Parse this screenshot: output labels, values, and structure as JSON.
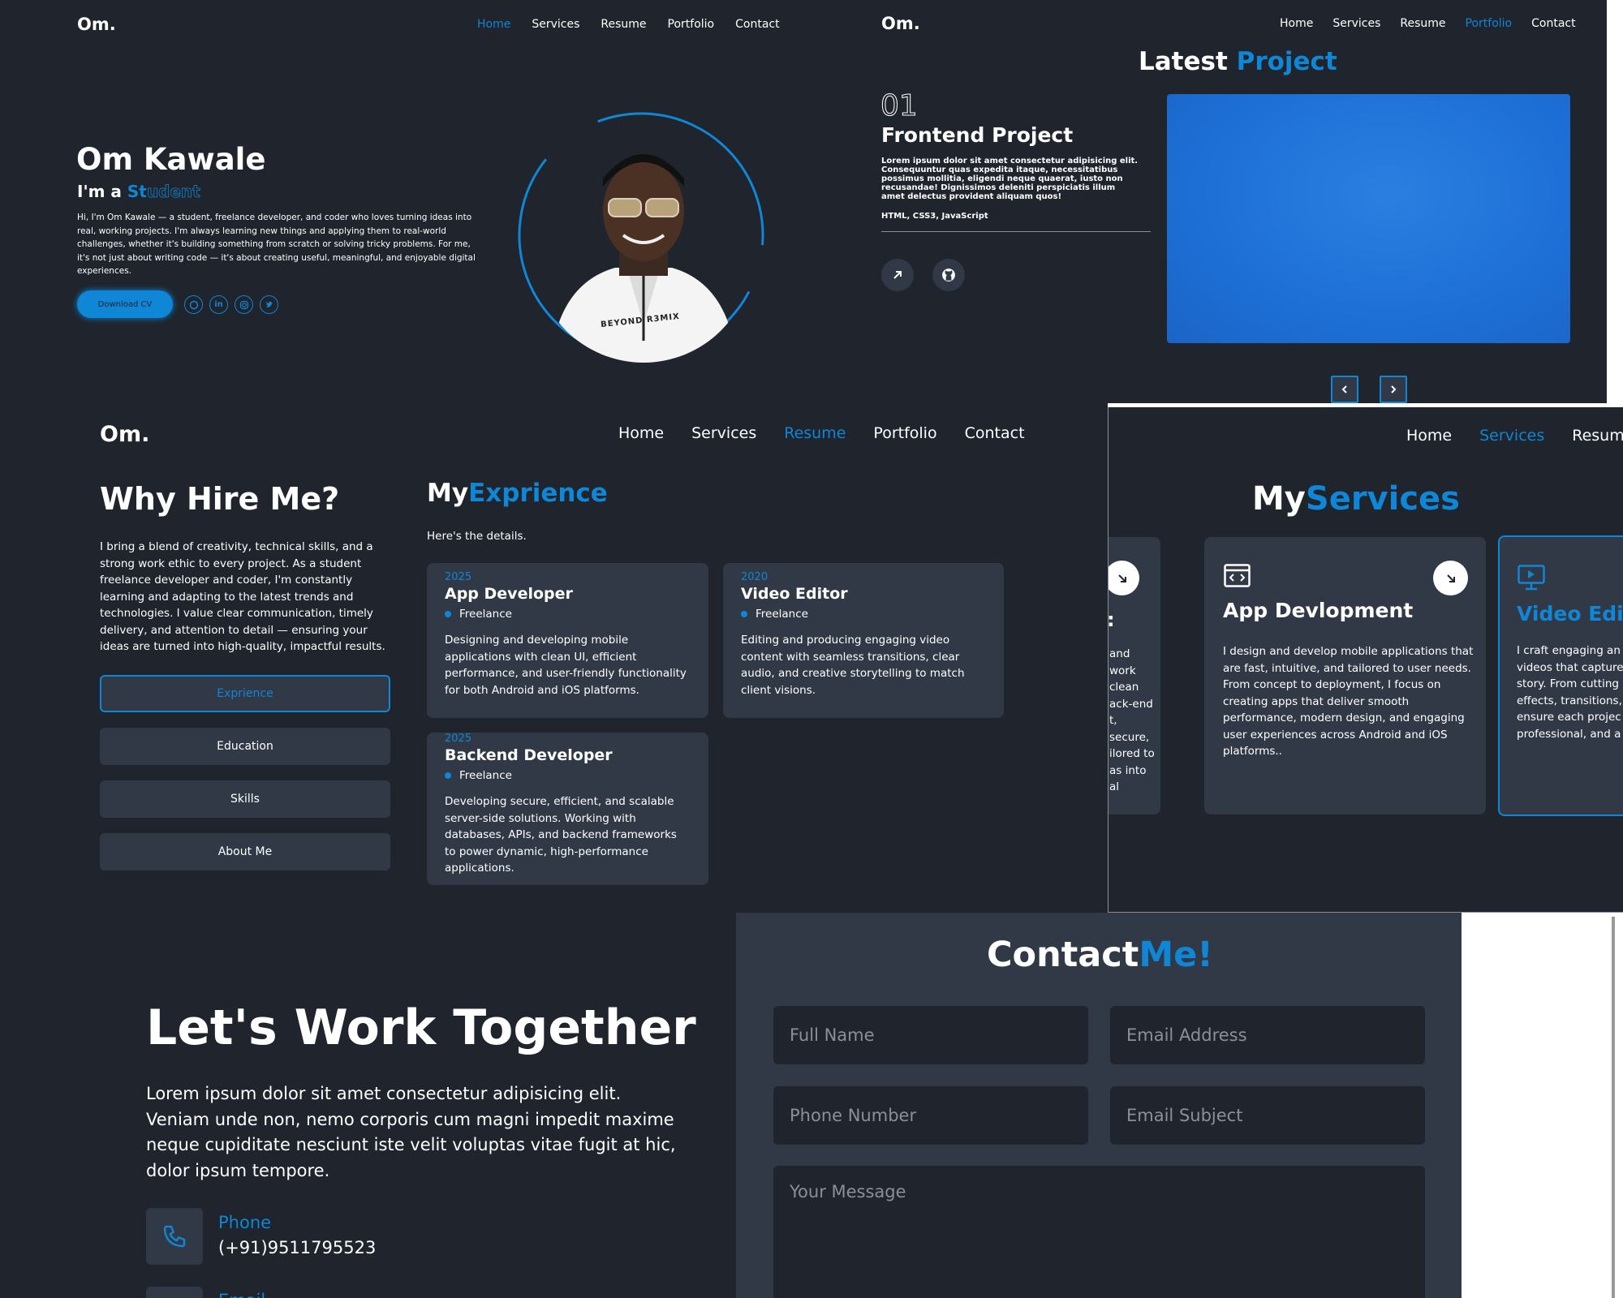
{
  "brand": {
    "logo": "Om.",
    "accent": "#0f86d6",
    "background": "#1f242d",
    "card": "#323946"
  },
  "home": {
    "nav": [
      "Home",
      "Services",
      "Resume",
      "Portfolio",
      "Contact"
    ],
    "active": "Home",
    "name": "Om Kawale",
    "role_prefix": "I'm a",
    "role_typed": "St",
    "role_ghost": "udent",
    "bio": "Hi, I'm Om Kawale — a student, freelance developer, and coder who loves turning ideas into real, working projects. I'm always learning new things and applying them to real-world challenges, whether it's building something from scratch or solving tricky problems. For me, it's not just about writing code — it's about creating useful, meaningful, and enjoyable digital experiences.",
    "cta": "Download CV",
    "socials": [
      "github-icon",
      "linkedin-icon",
      "instagram-icon",
      "twitter-icon"
    ],
    "shirt_text": "BEYOND R3MIX"
  },
  "portfolio": {
    "nav": [
      "Home",
      "Services",
      "Resume",
      "Portfolio",
      "Contact"
    ],
    "active": "Portfolio",
    "title_a": "Latest",
    "title_b": "Project",
    "number": "01",
    "project_title": "Frontend Project",
    "description": "Lorem ipsum dolor sit amet consectetur adipisicing elit. Consequuntur quas expedita itaque, necessitatibus possimus mollitia, eligendi neque quaerat, iusto non recusandae! Dignissimos deleniti perspiciatis illum amet delectus provident aliquam quos!",
    "tech": "HTML, CSS3, JavaScript",
    "links": [
      "arrow-up-right-icon",
      "github-icon"
    ]
  },
  "resume": {
    "nav": [
      "Home",
      "Services",
      "Resume",
      "Portfolio",
      "Contact"
    ],
    "active": "Resume",
    "why_title": "Why Hire Me?",
    "why_text": "I bring a blend of creativity, technical skills, and a strong work ethic to every project. As a student freelance developer and coder, I'm constantly learning and adapting to the latest trends and technologies. I value clear communication, timely delivery, and attention to detail — ensuring your ideas are turned into high-quality, impactful results.",
    "tabs": [
      "Exprience",
      "Education",
      "Skills",
      "About Me"
    ],
    "active_tab": "Exprience",
    "exp_title_a": "My",
    "exp_title_b": "Exprience",
    "exp_sub": "Here's the details.",
    "experiences": [
      {
        "year": "2025",
        "title": "App Developer",
        "type": "Freelance",
        "desc": "Designing and developing mobile applications with clean UI, efficient performance, and user-friendly functionality for both Android and iOS platforms."
      },
      {
        "year": "2020",
        "title": "Video Editor",
        "type": "Freelance",
        "desc": "Editing and producing engaging video content with seamless transitions, clear audio, and creative storytelling to match client visions."
      },
      {
        "year": "2025",
        "title": "Backend Developer",
        "type": "Freelance",
        "desc": "Developing secure, efficient, and scalable server-side solutions. Working with databases, APIs, and backend frameworks to power dynamic, high-performance applications."
      }
    ]
  },
  "services": {
    "nav": [
      "Home",
      "Services",
      "Resume"
    ],
    "active": "Services",
    "title_a": "My",
    "title_b": "Services",
    "partial_left_lines": [
      "and",
      "work",
      "clean",
      "ack-end",
      "t, secure,",
      "ilored to",
      "as into",
      "al"
    ],
    "partial_left_colon": ":",
    "cards": [
      {
        "title": "App Devlopment",
        "desc": "I design and develop mobile applications that are fast, intuitive, and tailored to user needs. From concept to deployment, I focus on creating apps that deliver smooth performance, modern design, and engaging user experiences across Android and iOS platforms.."
      },
      {
        "title": "Video Editi",
        "lines": [
          "I craft engaging an",
          "videos that capture",
          "story. From cutting",
          "effects, transitions,",
          "ensure each projec",
          "professional, and a"
        ]
      }
    ]
  },
  "contact": {
    "headline": "Let's Work Together",
    "text": "Lorem ipsum dolor sit amet consectetur adipisicing elit. Veniam unde non, nemo corporis cum magni impedit maxime neque cupiditate nesciunt iste velit voluptas vitae fugit at hic, dolor ipsum tempore.",
    "phone_label": "Phone",
    "phone": "(+91)9511795523",
    "email_label_partial": "Email",
    "form_title_a": "Contact",
    "form_title_b": "Me!",
    "placeholders": {
      "name": "Full Name",
      "email": "Email Address",
      "phone": "Phone Number",
      "subject": "Email Subject",
      "message": "Your Message"
    }
  }
}
